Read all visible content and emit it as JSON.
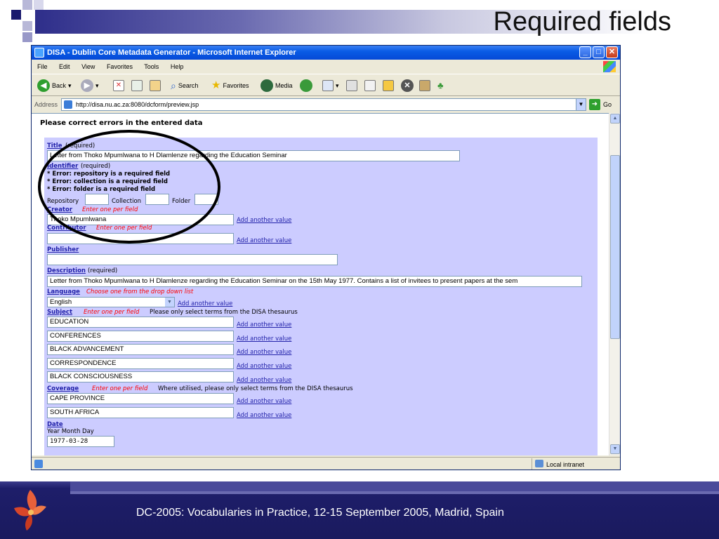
{
  "slide": {
    "title": "Required fields",
    "footer": "DC-2005: Vocabularies in Practice, 12-15 September 2005, Madrid, Spain"
  },
  "window": {
    "title": "DISA - Dublin Core Metadata Generator - Microsoft Internet Explorer",
    "menu": [
      "File",
      "Edit",
      "View",
      "Favorites",
      "Tools",
      "Help"
    ],
    "toolbar": {
      "back": "Back",
      "search": "Search",
      "favorites": "Favorites",
      "media": "Media"
    },
    "address_label": "Address",
    "address_url": "http://disa.nu.ac.za:8080/dcform/preview.jsp",
    "go_label": "Go",
    "status_zone": "Local intranet"
  },
  "page": {
    "heading": "Please correct errors in the entered data",
    "title_field": {
      "label": "Title",
      "note": "(required)",
      "value": "Letter from Thoko Mpumlwana to H Dlamlenze regarding the Education Seminar"
    },
    "identifier_field": {
      "label": "Identifier",
      "note": "(required)",
      "errors": [
        "* Error: repository is a required field",
        "* Error: collection is a required field",
        "* Error: folder is a required field"
      ],
      "repository_label": "Repository",
      "collection_label": "Collection",
      "folder_label": "Folder"
    },
    "creator_field": {
      "label": "Creator",
      "hint": "Enter one per field",
      "value": "Thoko Mpumlwana"
    },
    "contributor_field": {
      "label": "Contributor",
      "hint": "Enter one per field",
      "value": ""
    },
    "publisher_field": {
      "label": "Publisher",
      "value": ""
    },
    "description_field": {
      "label": "Description",
      "note": "(required)",
      "value": "Letter from Thoko Mpumlwana to H Dlamlenze regarding the Education Seminar on the 15th May 1977. Contains a list of invitees to present papers at the sem"
    },
    "language_field": {
      "label": "Language",
      "hint": "Choose one from the drop down list",
      "value": "English"
    },
    "subject_field": {
      "label": "Subject",
      "hint": "Enter one per field",
      "note": "Please only select terms from the DISA thesaurus",
      "values": [
        "EDUCATION",
        "CONFERENCES",
        "BLACK ADVANCEMENT",
        "CORRESPONDENCE",
        "BLACK CONSCIOUSNESS"
      ]
    },
    "coverage_field": {
      "label": "Coverage",
      "hint": "Enter one per field",
      "note": "Where utilised, please only select terms from the DISA thesaurus",
      "values": [
        "CAPE PROVINCE",
        "SOUTH AFRICA"
      ]
    },
    "date_field": {
      "label": "Date",
      "subtitle": "Year Month Day",
      "value": "1977-03-28"
    },
    "add_another_label": "Add another value"
  },
  "colors": {
    "form_bg": "#ccccff",
    "link": "#2222aa",
    "hint": "#ff0000",
    "footer_bg": "#1a1a5e"
  }
}
